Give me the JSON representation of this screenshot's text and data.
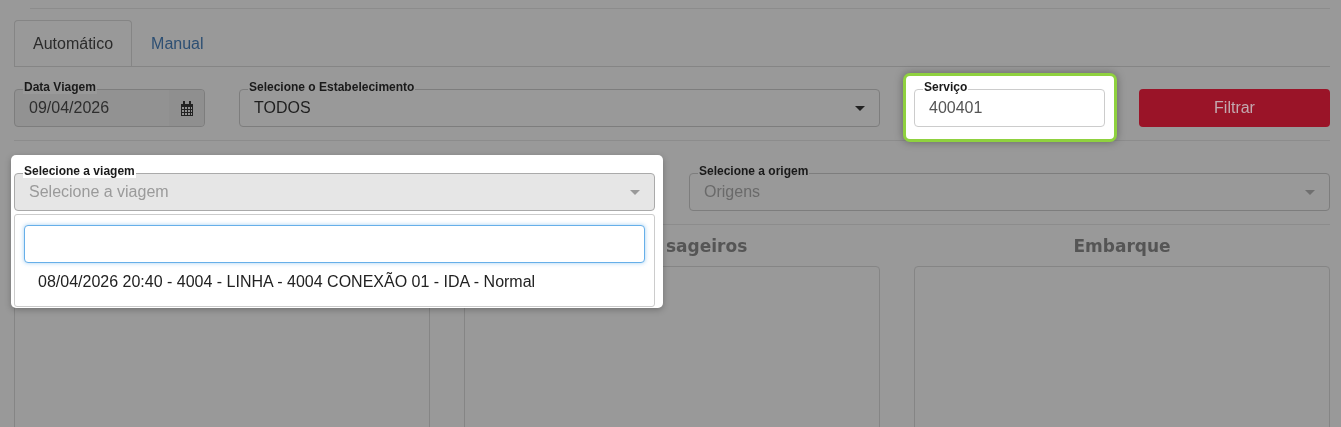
{
  "tabs": [
    {
      "label": "Automático",
      "selected": true
    },
    {
      "label": "Manual",
      "selected": false
    }
  ],
  "filters": {
    "date": {
      "label": "Data Viagem",
      "value": "09/04/2026"
    },
    "establishment": {
      "label": "Selecione o Estabelecimento",
      "value": "TODOS"
    },
    "service": {
      "label": "Serviço",
      "value": "400401",
      "highlighted": true
    },
    "filter_button": "Filtrar"
  },
  "trip_select": {
    "label": "Selecione a viagem",
    "placeholder": "Selecione a viagem",
    "expanded": true,
    "options": [
      {
        "label": "08/04/2026 20:40 - 4004 - LINHA - 4004 CONEXÃO 01 - IDA - Normal",
        "selected": false
      }
    ]
  },
  "origin_select": {
    "label": "Selecione a origem",
    "placeholder": "Origens"
  },
  "panels": [
    {
      "kind": "hidden"
    },
    {
      "kind": "cut",
      "heading": "sageiros"
    },
    {
      "kind": "plain",
      "heading": "Embarque"
    }
  ]
}
